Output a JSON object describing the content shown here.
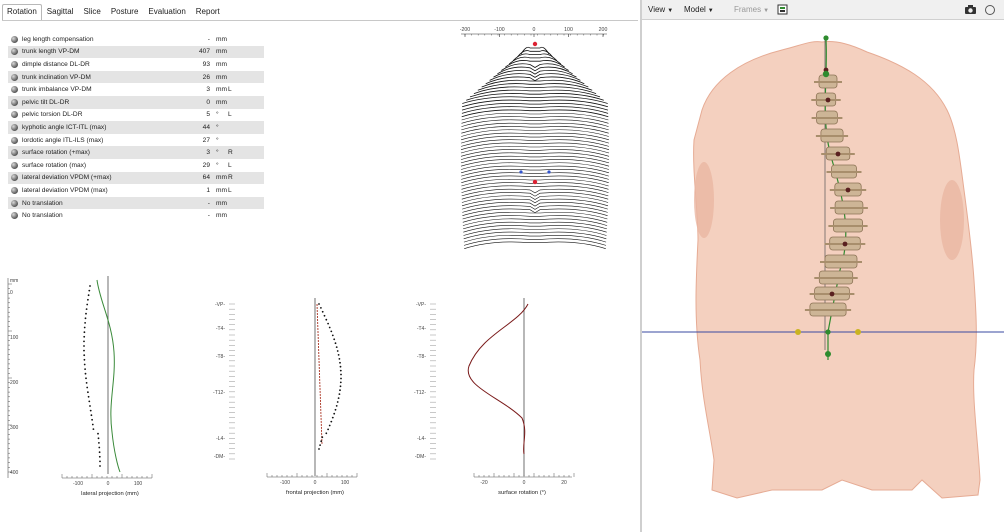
{
  "tabs": [
    "Rotation",
    "Sagittal",
    "Slice",
    "Posture",
    "Evaluation",
    "Report"
  ],
  "params": [
    {
      "label": "leg length compensation",
      "value": "-",
      "unit": "mm",
      "suffix": ""
    },
    {
      "label": "trunk length VP-DM",
      "value": "407",
      "unit": "mm",
      "suffix": ""
    },
    {
      "label": "dimple distance DL-DR",
      "value": "93",
      "unit": "mm",
      "suffix": ""
    },
    {
      "label": "trunk inclination VP-DM",
      "value": "26",
      "unit": "mm",
      "suffix": ""
    },
    {
      "label": "trunk imbalance VP-DM",
      "value": "3",
      "unit": "mm",
      "suffix": "L"
    },
    {
      "label": "pelvic tilt DL-DR",
      "value": "0",
      "unit": "mm",
      "suffix": ""
    },
    {
      "label": "pelvic torsion DL-DR",
      "value": "5",
      "unit": "°",
      "suffix": "L"
    },
    {
      "label": "kyphotic angle ICT-ITL (max)",
      "value": "44",
      "unit": "°",
      "suffix": ""
    },
    {
      "label": "lordotic angle ITL-ILS (max)",
      "value": "27",
      "unit": "°",
      "suffix": ""
    },
    {
      "label": "surface rotation (+max)",
      "value": "3",
      "unit": "°",
      "suffix": "R"
    },
    {
      "label": "surface rotation (max)",
      "value": "29",
      "unit": "°",
      "suffix": "L"
    },
    {
      "label": "lateral deviation VPDM (+max)",
      "value": "64",
      "unit": "mm",
      "suffix": "R"
    },
    {
      "label": "lateral deviation VPDM (max)",
      "value": "1",
      "unit": "mm",
      "suffix": "L"
    },
    {
      "label": "No translation",
      "value": "-",
      "unit": "mm",
      "suffix": ""
    },
    {
      "label": "No translation",
      "value": "-",
      "unit": "mm",
      "suffix": ""
    }
  ],
  "topography": {
    "x_ticks": [
      "-200",
      "-100",
      "0",
      "100",
      "200"
    ]
  },
  "plots": {
    "lateral": {
      "title": "lateral projection (mm)",
      "y_unit": "mm",
      "y_ticks": [
        "0",
        "100",
        "200",
        "300",
        "400"
      ],
      "x_ticks": [
        "-100",
        "0",
        "100"
      ]
    },
    "frontal": {
      "title": "frontal projection (mm)",
      "x_ticks": [
        "-100",
        "0",
        "100"
      ]
    },
    "rotation": {
      "title": "surface rotation (°)",
      "x_ticks": [
        "-20",
        "0",
        "20"
      ]
    },
    "landmarks": [
      "VP",
      "T4",
      "T8",
      "T12",
      "L4",
      "DM"
    ]
  },
  "viewer": {
    "view_label": "View",
    "model_label": "Model",
    "frames_label": "Frames",
    "colors": {
      "skin": "#f2c8b4",
      "spine": "#cdb596",
      "line": "#2e8b2e",
      "axis_h": "#3a4aa0"
    }
  }
}
